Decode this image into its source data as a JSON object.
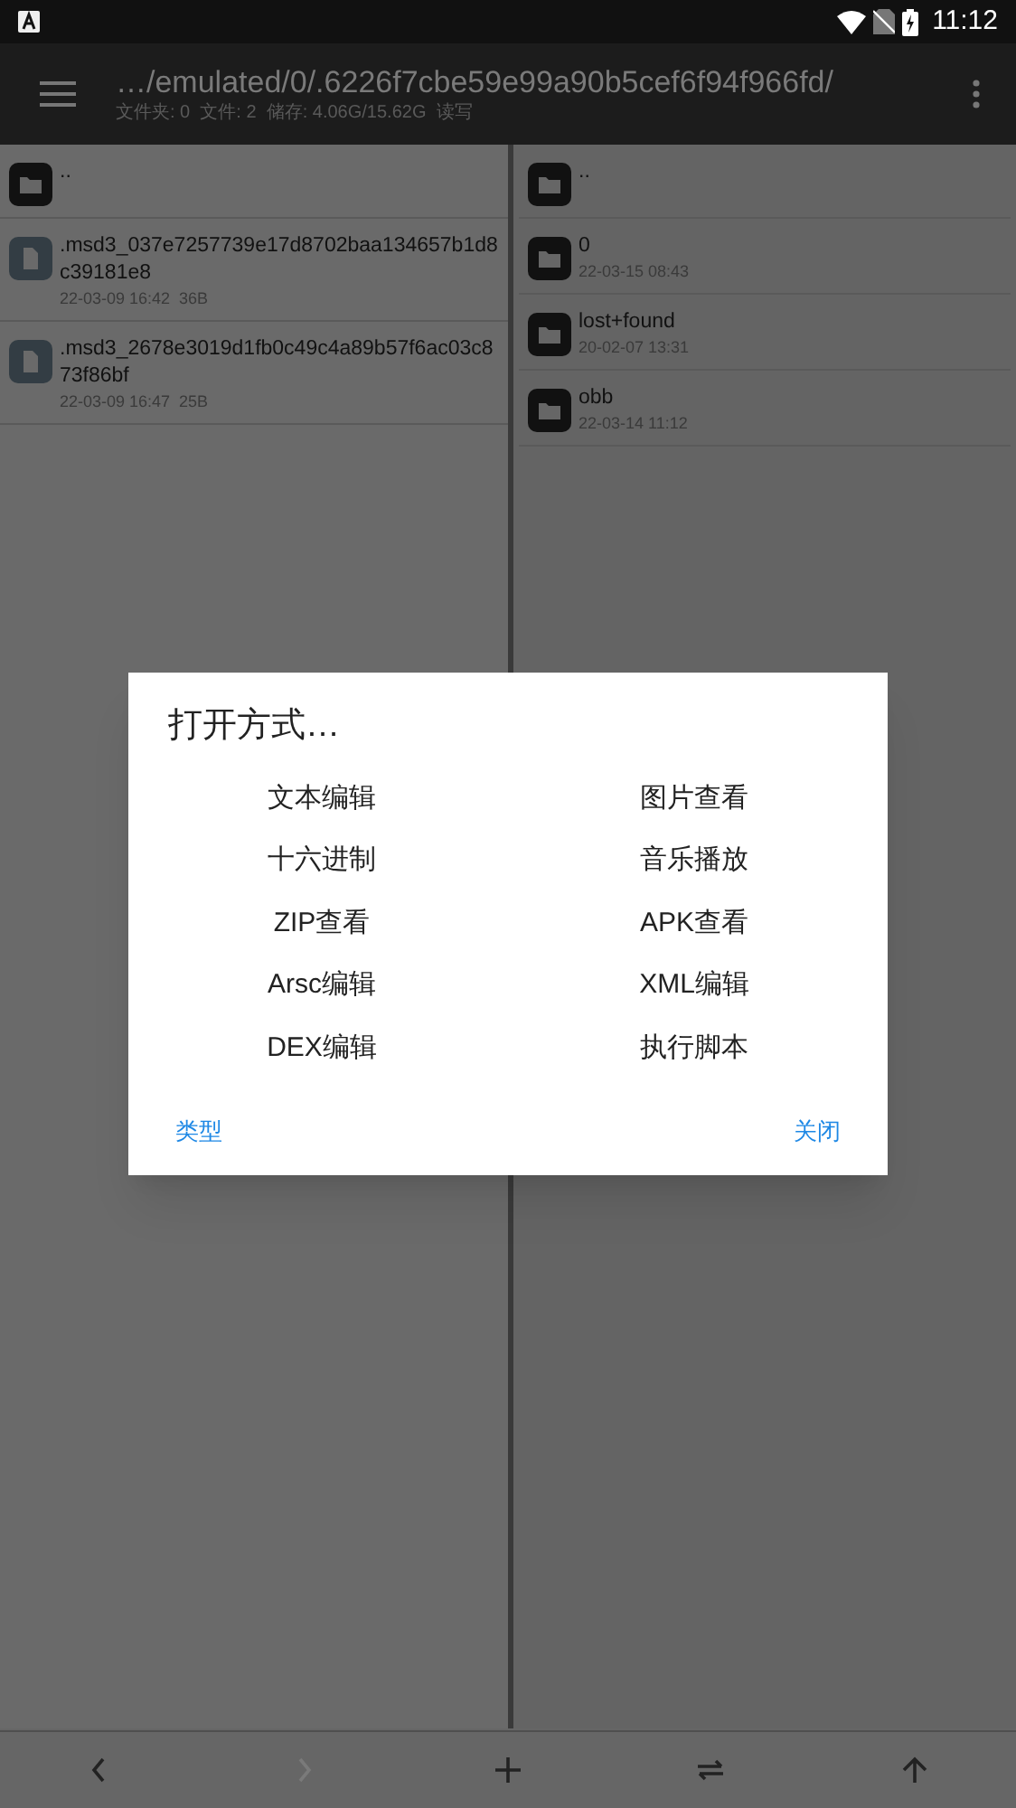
{
  "status_bar": {
    "time": "11:12"
  },
  "toolbar": {
    "path": "…/emulated/0/.6226f7cbe59e99a90b5cef6f94f966fd/",
    "info": "文件夹: 0  文件: 2  储存: 4.06G/15.62G  读写"
  },
  "left_pane": [
    {
      "kind": "folder",
      "name": ".."
    },
    {
      "kind": "file",
      "name": ".msd3_037e7257739e17d8702baa134657b1d8c39181e8",
      "meta": "22-03-09 16:42  36B"
    },
    {
      "kind": "file",
      "name": ".msd3_2678e3019d1fb0c49c4a89b57f6ac03c873f86bf",
      "meta": "22-03-09 16:47  25B"
    }
  ],
  "right_pane": [
    {
      "kind": "folder",
      "name": ".."
    },
    {
      "kind": "folder",
      "name": "0",
      "meta": "22-03-15 08:43"
    },
    {
      "kind": "folder",
      "name": "lost+found",
      "meta": "20-02-07 13:31"
    },
    {
      "kind": "folder",
      "name": "obb",
      "meta": "22-03-14 11:12"
    }
  ],
  "dialog": {
    "title": "打开方式…",
    "options": [
      "文本编辑",
      "图片查看",
      "十六进制",
      "音乐播放",
      "ZIP查看",
      "APK查看",
      "Arsc编辑",
      "XML编辑",
      "DEX编辑",
      "执行脚本"
    ],
    "buttons": [
      "类型",
      "关闭"
    ]
  },
  "bottom_bar": [
    {
      "kind": "back",
      "disabled": false
    },
    {
      "kind": "forward",
      "disabled": true
    },
    {
      "kind": "add",
      "disabled": false
    },
    {
      "kind": "swap",
      "disabled": false
    },
    {
      "kind": "up",
      "disabled": false
    }
  ]
}
